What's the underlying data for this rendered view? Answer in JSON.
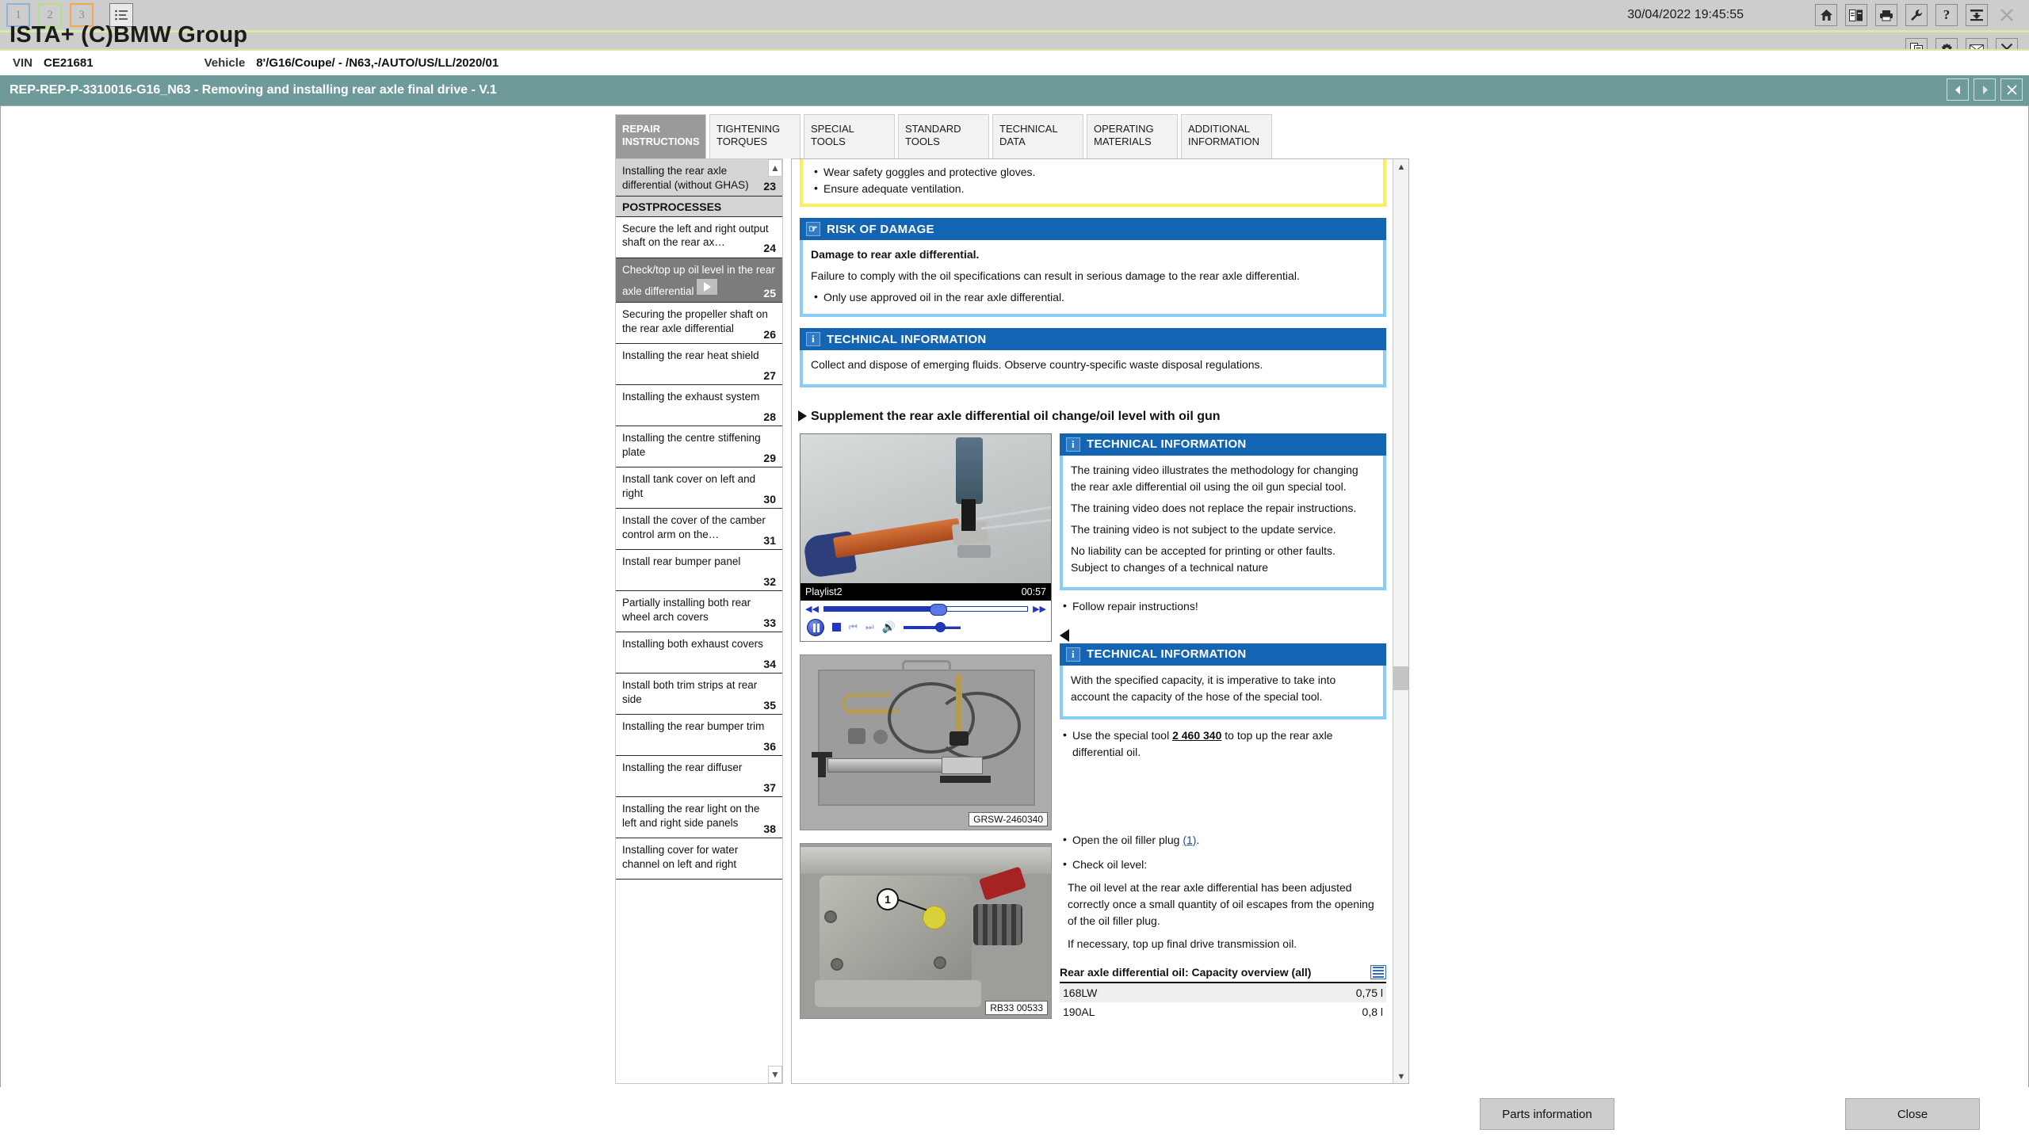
{
  "window": {
    "app_title": "ISTA+ (C)BMW Group",
    "timestamp": "30/04/2022 19:45:55"
  },
  "nav_badges": [
    {
      "label": "1",
      "color": "#8fb4d9"
    },
    {
      "label": "2",
      "color": "#b4dd8c"
    },
    {
      "label": "3",
      "color": "#f0a94c"
    }
  ],
  "nav_list_icon": "list-icon",
  "toolbar_row1": [
    {
      "name": "home-icon",
      "glyph": "home"
    },
    {
      "name": "document-exchange-icon",
      "glyph": "docswap"
    },
    {
      "name": "print-icon",
      "glyph": "printer"
    },
    {
      "name": "wrench-icon",
      "glyph": "wrench"
    },
    {
      "name": "help-icon",
      "glyph": "?"
    },
    {
      "name": "export-icon",
      "glyph": "export"
    },
    {
      "name": "close-window-icon",
      "glyph": "x"
    }
  ],
  "toolbar_row2": [
    {
      "name": "copy-document-icon",
      "glyph": "copydoc"
    },
    {
      "name": "settings-gear-icon",
      "glyph": "gear"
    },
    {
      "name": "mail-icon",
      "glyph": "mail"
    },
    {
      "name": "close-icon",
      "glyph": "x"
    }
  ],
  "vehicle_bar": {
    "vin_label": "VIN",
    "vin_value": "CE21681",
    "vehicle_label": "Vehicle",
    "vehicle_value": "8'/G16/Coupe/ - /N63,-/AUTO/US/LL/2020/01"
  },
  "procedure_bar": {
    "title": "REP-REP-P-3310016-G16_N63 - Removing and installing rear axle final drive - V.1",
    "prev_label": "◀",
    "next_label": "▶",
    "close_label": "✕"
  },
  "tabs": [
    {
      "label": "REPAIR INSTRUCTIONS",
      "active": true
    },
    {
      "label": "TIGHTENING TORQUES",
      "active": false
    },
    {
      "label": "SPECIAL TOOLS",
      "active": false
    },
    {
      "label": "STANDARD TOOLS",
      "active": false
    },
    {
      "label": "TECHNICAL DATA",
      "active": false
    },
    {
      "label": "OPERATING MATERIALS",
      "active": false
    },
    {
      "label": "ADDITIONAL INFORMATION",
      "active": false
    }
  ],
  "steps": [
    {
      "text": "Installing the rear axle differential (without GHAS)",
      "num": "23",
      "type": "partial"
    },
    {
      "text": "POSTPROCESSES",
      "num": "",
      "type": "section"
    },
    {
      "text": "Secure the left and right output shaft on the rear ax…",
      "num": "24",
      "type": "normal"
    },
    {
      "text": "Check/top up oil level in the rear axle differential",
      "num": "25",
      "type": "selected",
      "has_play": true
    },
    {
      "text": "Securing the propeller shaft on the rear axle differential",
      "num": "26",
      "type": "normal"
    },
    {
      "text": "Installing the rear heat shield",
      "num": "27",
      "type": "normal"
    },
    {
      "text": "Installing the exhaust system",
      "num": "28",
      "type": "normal"
    },
    {
      "text": "Installing the centre stiffening plate",
      "num": "29",
      "type": "normal"
    },
    {
      "text": "Install tank cover on left and right",
      "num": "30",
      "type": "normal"
    },
    {
      "text": "Install the cover of the camber control arm on the…",
      "num": "31",
      "type": "normal"
    },
    {
      "text": "Install rear bumper panel",
      "num": "32",
      "type": "normal"
    },
    {
      "text": "Partially installing both rear wheel arch covers",
      "num": "33",
      "type": "normal"
    },
    {
      "text": "Installing both exhaust covers",
      "num": "34",
      "type": "normal"
    },
    {
      "text": "Install both trim strips at rear side",
      "num": "35",
      "type": "normal"
    },
    {
      "text": "Installing the rear bumper trim",
      "num": "36",
      "type": "normal"
    },
    {
      "text": "Installing the rear diffuser",
      "num": "37",
      "type": "normal"
    },
    {
      "text": "Installing the rear light on the left and right side panels",
      "num": "38",
      "type": "normal"
    },
    {
      "text": "Installing cover for water channel on left and right",
      "num": "",
      "type": "cut"
    }
  ],
  "document": {
    "warning_bullets": [
      "Wear safety goggles and protective gloves.",
      "Ensure adequate ventilation."
    ],
    "risk_box": {
      "header": "RISK OF DAMAGE",
      "icon": "hand-pointer-icon",
      "heading": "Damage to rear axle differential.",
      "body": "Failure to comply with the oil specifications can result in serious damage to the rear axle differential.",
      "bullet": "Only use approved oil in the rear axle differential."
    },
    "tech_box_1": {
      "header": "TECHNICAL INFORMATION",
      "icon": "info-icon",
      "body": "Collect and dispose of emerging fluids. Observe country-specific waste disposal regulations."
    },
    "section_heading": "Supplement the rear axle differential oil change/oil level with oil gun",
    "video": {
      "playlist_label": "Playlist2",
      "duration": "00:57",
      "rewind_icon": "rewind-icon",
      "forward_icon": "fast-forward-icon",
      "pause_icon": "pause-icon",
      "stop_icon": "stop-icon",
      "prev_icon": "previous-track-icon",
      "next_icon": "next-track-icon",
      "volume_icon": "volume-icon"
    },
    "tech_box_2": {
      "header": "TECHNICAL INFORMATION",
      "icon": "info-icon",
      "lines": [
        "The training video illustrates the methodology for changing the rear axle differential oil using the oil gun special tool.",
        "The training video does not replace the repair instructions.",
        "The training video is not subject to the update service.",
        "No liability can be accepted for printing or other faults. Subject to changes of a technical nature"
      ]
    },
    "follow_bullet": "Follow repair instructions!",
    "back_arrow_icon": "back-triangle-icon",
    "tech_box_3": {
      "header": "TECHNICAL INFORMATION",
      "icon": "info-icon",
      "body": "With the specified capacity, it is imperative to take into account the capacity of the hose of the special tool."
    },
    "special_tool_bullet_pre": "Use the special tool ",
    "special_tool_number": "2 460 340",
    "special_tool_bullet_post": " to top up the rear axle differential oil.",
    "photo_tool_caption": "GRSW-2460340",
    "photo_diff_caption": "RB33 00533",
    "photo_diff_callout": "1",
    "open_plug_pre": "Open the oil filler plug ",
    "open_plug_link": "(1)",
    "open_plug_post": ".",
    "check_oil_bullet": "Check oil level:",
    "check_oil_para1": "The oil level at the rear axle differential has been adjusted correctly once a small quantity of oil escapes from the opening of the oil filler plug.",
    "check_oil_para2": "If necessary, top up final drive transmission oil.",
    "capacity": {
      "title": "Rear axle differential oil: Capacity overview (all)",
      "table_icon": "table-icon",
      "rows": [
        {
          "name": "168LW",
          "value": "0,75 l"
        },
        {
          "name": "190AL",
          "value": "0,8 l"
        }
      ]
    }
  },
  "footer": {
    "parts_information_label": "Parts information",
    "close_label": "Close"
  },
  "colors": {
    "accent_teal": "#6e9a9a",
    "info_blue": "#1464b4",
    "info_border": "#87cdf5",
    "warning_yellow": "#faf05a",
    "chrome_gray": "#cdcdcd",
    "selected_step": "#7c7c7c"
  }
}
